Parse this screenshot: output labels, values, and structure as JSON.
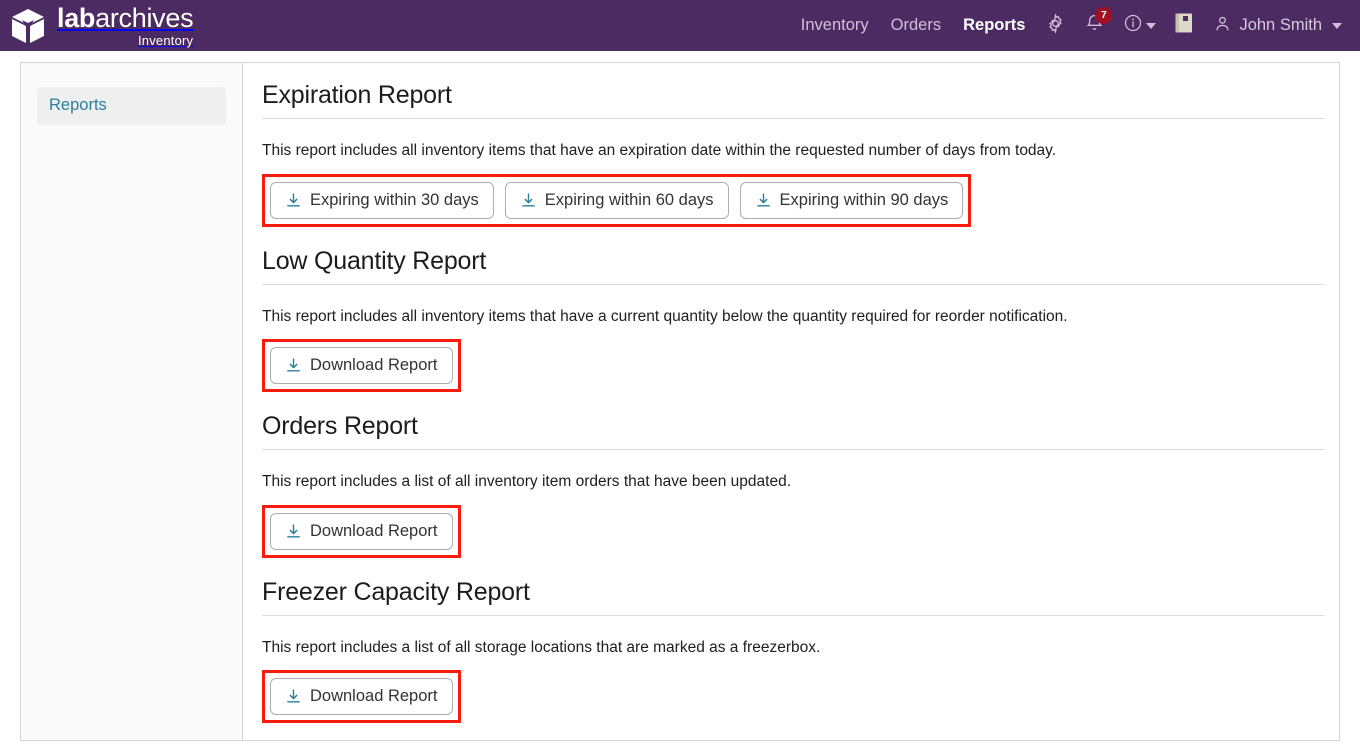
{
  "brand": {
    "name_bold": "lab",
    "name_light": "archives",
    "subtitle": "Inventory",
    "logo_icon": "open-box-cube-icon"
  },
  "topnav": {
    "links": [
      {
        "label": "Inventory",
        "active": false
      },
      {
        "label": "Orders",
        "active": false
      },
      {
        "label": "Reports",
        "active": true
      }
    ],
    "icons": [
      {
        "name": "gear-icon"
      },
      {
        "name": "bell-icon",
        "badge": "7"
      },
      {
        "name": "info-circle-icon"
      },
      {
        "name": "notebook-icon"
      }
    ],
    "user": {
      "name": "John Smith",
      "avatar_icon": "person-icon",
      "caret_icon": "caret-down-icon"
    }
  },
  "sidebar": {
    "items": [
      {
        "label": "Reports",
        "active": true
      }
    ]
  },
  "colors": {
    "header_purple": "#4c2a62",
    "accent_teal": "#2a7f9e",
    "annotation_red": "#fb1b0c",
    "badge_red": "#a01020"
  },
  "sections": [
    {
      "id": "expiration",
      "title": "Expiration Report",
      "description": "This report includes all inventory items that have an expiration date within the requested number of days from today.",
      "annotated": true,
      "buttons": [
        {
          "label": "Expiring within 30 days",
          "icon": "download-icon"
        },
        {
          "label": "Expiring within 60 days",
          "icon": "download-icon"
        },
        {
          "label": "Expiring within 90 days",
          "icon": "download-icon"
        }
      ]
    },
    {
      "id": "low-quantity",
      "title": "Low Quantity Report",
      "description": "This report includes all inventory items that have a current quantity below the quantity required for reorder notification.",
      "annotated": true,
      "buttons": [
        {
          "label": "Download Report",
          "icon": "download-icon"
        }
      ]
    },
    {
      "id": "orders",
      "title": "Orders Report",
      "description": "This report includes a list of all inventory item orders that have been updated.",
      "annotated": true,
      "buttons": [
        {
          "label": "Download Report",
          "icon": "download-icon"
        }
      ]
    },
    {
      "id": "freezer-capacity",
      "title": "Freezer Capacity Report",
      "description": "This report includes a list of all storage locations that are marked as a freezerbox.",
      "annotated": true,
      "buttons": [
        {
          "label": "Download Report",
          "icon": "download-icon"
        }
      ]
    }
  ]
}
